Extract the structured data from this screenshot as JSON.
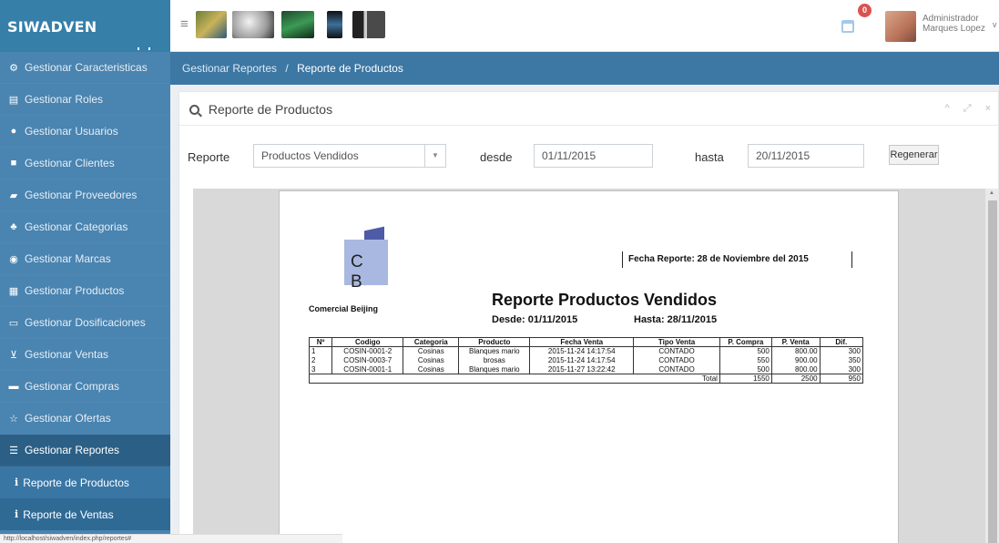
{
  "brand": "SIWADVEN",
  "colors": {
    "sidebar": "#4a84b0",
    "brand": "#367fa9",
    "breadcrumb": "#3d77a3",
    "active": "#2b5f86"
  },
  "sidebar": {
    "items": [
      {
        "label": "Gestionar Caracteristicas",
        "icon": "cogs-icon"
      },
      {
        "label": "Gestionar Roles",
        "icon": "id-card-icon"
      },
      {
        "label": "Gestionar Usuarios",
        "icon": "users-icon"
      },
      {
        "label": "Gestionar Clientes",
        "icon": "briefcase-icon"
      },
      {
        "label": "Gestionar Proveedores",
        "icon": "truck-icon"
      },
      {
        "label": "Gestionar Categorias",
        "icon": "sitemap-icon"
      },
      {
        "label": "Gestionar Marcas",
        "icon": "bullseye-icon"
      },
      {
        "label": "Gestionar Productos",
        "icon": "product-icon"
      },
      {
        "label": "Gestionar Dosificaciones",
        "icon": "document-icon"
      },
      {
        "label": "Gestionar Ventas",
        "icon": "cart-icon"
      },
      {
        "label": "Gestionar Compras",
        "icon": "purchase-icon"
      },
      {
        "label": "Gestionar Ofertas",
        "icon": "star-icon"
      },
      {
        "label": "Gestionar Reportes",
        "icon": "report-icon"
      }
    ],
    "sub_items": [
      {
        "label": "Reporte de Productos"
      },
      {
        "label": "Reporte de Ventas"
      }
    ]
  },
  "topbar": {
    "user_line1": "Administrador",
    "user_line2": "Marques Lopez",
    "notification_count": "0"
  },
  "breadcrumb": {
    "parent": "Gestionar Reportes",
    "separator": "/",
    "current": "Reporte de Productos"
  },
  "box": {
    "title": "Reporte de Productos",
    "tools": "^ ⤢ ×"
  },
  "filters": {
    "reporte_label": "Reporte",
    "reporte_value": "Productos Vendidos",
    "desde_label": "desde",
    "desde_value": "01/11/2015",
    "hasta_label": "hasta",
    "hasta_value": "20/11/2015",
    "button": "Regenerar"
  },
  "report": {
    "logo_letters": "C B",
    "company": "Comercial Beijing",
    "fecha_reporte": "Fecha Reporte: 28 de Noviembre del 2015",
    "title": "Reporte Productos Vendidos",
    "desde": "Desde: 01/11/2015",
    "hasta": "Hasta: 28/11/2015",
    "headers": [
      "Nº",
      "Codigo",
      "Categoria",
      "Producto",
      "Fecha Venta",
      "Tipo Venta",
      "P. Compra",
      "P. Venta",
      "Dif."
    ],
    "rows": [
      [
        "1",
        "COSIN-0001-2",
        "Cosinas",
        "Blanques mario",
        "2015-11-24 14:17:54",
        "CONTADO",
        "500",
        "800.00",
        "300"
      ],
      [
        "2",
        "COSIN-0003-7",
        "Cosinas",
        "brosas",
        "2015-11-24 14:17:54",
        "CONTADO",
        "550",
        "900.00",
        "350"
      ],
      [
        "3",
        "COSIN-0001-1",
        "Cosinas",
        "Blanques mario",
        "2015-11-27 13:22:42",
        "CONTADO",
        "500",
        "800.00",
        "300"
      ]
    ],
    "total_label": "Total",
    "total_compra": "1550",
    "total_venta": "2500",
    "total_dif": "950"
  },
  "status_url": "http://localhost/siwadven/index.php/reportes#"
}
